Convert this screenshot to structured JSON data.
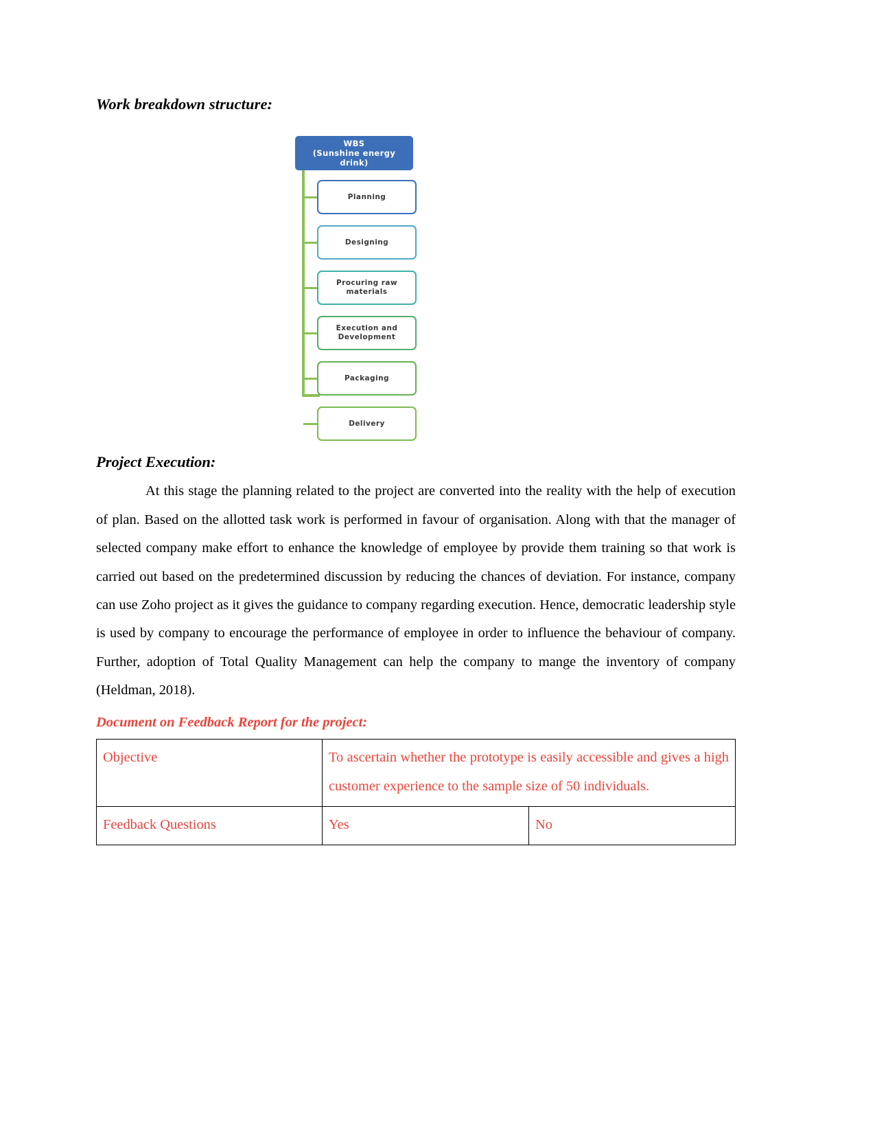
{
  "document": {
    "wbs_heading": "Work breakdown structure:",
    "execution_heading": "Project Execution:",
    "execution_paragraph": "At this stage the planning related to the project are converted into the reality with the help of execution of plan. Based on the allotted task work is performed in favour of organisation. Along with that the manager of selected company make effort to enhance the knowledge of employee by provide them training so that work is carried out based on the predetermined discussion by reducing the chances of deviation. For instance, company can use Zoho project as it gives the guidance to company regarding execution. Hence, democratic leadership style is used by company to encourage the performance of employee in order to influence the behaviour of company. Further, adoption of Total Quality Management can help the company to mange the inventory of company (Heldman,  2018).",
    "feedback_heading": "Document on Feedback Report for the project:"
  },
  "wbs_diagram": {
    "root": {
      "line1": "WBS",
      "line2": "(Sunshine energy drink)",
      "color": "#3C6FB8",
      "text_color": "#FFFFFF"
    },
    "spine_color": "#8CBF5A",
    "nodes": [
      {
        "label": "Planning",
        "border_color": "#3C6FB8"
      },
      {
        "label": "Designing",
        "border_color": "#4FA9C8"
      },
      {
        "label": "Procuring raw materials",
        "border_color": "#3FAFA8"
      },
      {
        "label": "Execution and Development",
        "border_color": "#4FAE6A"
      },
      {
        "label": "Packaging",
        "border_color": "#62B054"
      },
      {
        "label": "Delivery",
        "border_color": "#7CBA52"
      }
    ]
  },
  "feedback_table": {
    "accent_color": "#E8453C",
    "rows": [
      {
        "label": "Objective",
        "value": "To ascertain whether the prototype is easily accessible and gives a high customer experience to the sample size of 50 individuals."
      },
      {
        "label": "Feedback Questions",
        "yes": "Yes",
        "no": "No"
      }
    ]
  }
}
